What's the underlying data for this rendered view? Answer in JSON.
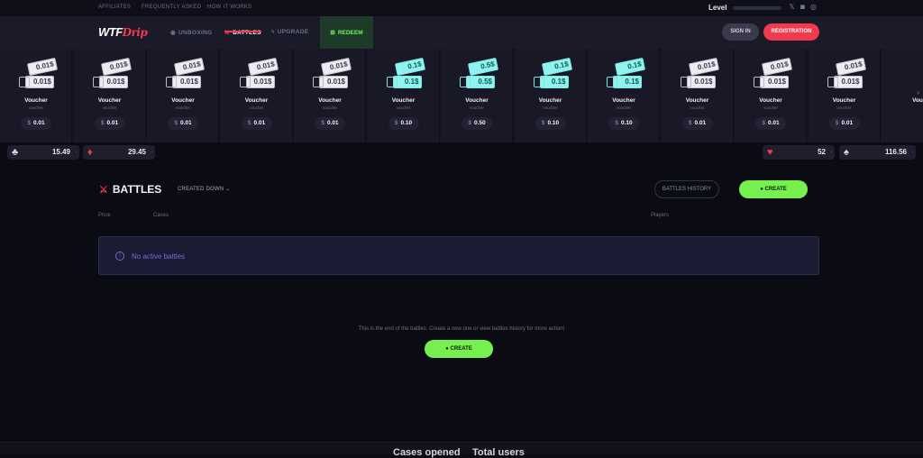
{
  "topbar": {
    "links": [
      "AFFILIATES",
      "FREQUENTLY ASKED",
      "HOW IT WORKS"
    ],
    "level_label": "Level",
    "social_icons": [
      "x-icon",
      "discord-icon",
      "instagram-icon"
    ]
  },
  "navbar": {
    "logo_main": "WTF",
    "logo_accent": "Drip",
    "items": [
      {
        "label": "UNBOXING",
        "icon": "cube-icon",
        "active": false
      },
      {
        "label": "BATTLES",
        "icon": "sword-icon",
        "active": true
      },
      {
        "label": "UPGRADE",
        "icon": "bolt-icon",
        "active": false
      }
    ],
    "redeem_label": "REDEEM",
    "signin_label": "SIGN IN",
    "register_label": "REGISTRATION"
  },
  "vouchers": [
    {
      "ticket": "0.01$",
      "name": "Voucher",
      "sub": "voucher",
      "price": "0.01",
      "tier": "grey"
    },
    {
      "ticket": "0.01$",
      "name": "Voucher",
      "sub": "voucher",
      "price": "0.01",
      "tier": "grey"
    },
    {
      "ticket": "0.01$",
      "name": "Voucher",
      "sub": "voucher",
      "price": "0.01",
      "tier": "grey"
    },
    {
      "ticket": "0.01$",
      "name": "Voucher",
      "sub": "voucher",
      "price": "0.01",
      "tier": "grey"
    },
    {
      "ticket": "0.01$",
      "name": "Voucher",
      "sub": "voucher",
      "price": "0.01",
      "tier": "grey"
    },
    {
      "ticket": "0.1$",
      "name": "Voucher",
      "sub": "voucher",
      "price": "0.10",
      "tier": "cyan"
    },
    {
      "ticket": "0.5$",
      "name": "Voucher",
      "sub": "voucher",
      "price": "0.50",
      "tier": "cyan"
    },
    {
      "ticket": "0.1$",
      "name": "Voucher",
      "sub": "voucher",
      "price": "0.10",
      "tier": "cyan"
    },
    {
      "ticket": "0.1$",
      "name": "Voucher",
      "sub": "voucher",
      "price": "0.10",
      "tier": "cyan"
    },
    {
      "ticket": "0.01$",
      "name": "Voucher",
      "sub": "voucher",
      "price": "0.01",
      "tier": "grey"
    },
    {
      "ticket": "0.01$",
      "name": "Voucher",
      "sub": "voucher",
      "price": "0.01",
      "tier": "grey"
    },
    {
      "ticket": "0.01$",
      "name": "Voucher",
      "sub": "voucher",
      "price": "0.01",
      "tier": "grey"
    },
    {
      "ticket": "",
      "name": "Vou",
      "sub": "",
      "price": "",
      "tier": "grey"
    }
  ],
  "stats": [
    {
      "suit": "♣",
      "value": "15.49",
      "color": "#d8d8e4"
    },
    {
      "suit": "♦",
      "value": "29.45",
      "color": "#ef3b4d"
    },
    {
      "suit": "♥",
      "value": "52",
      "color": "#ef3b4d"
    },
    {
      "suit": "♠",
      "value": "116.56",
      "color": "#d8d8e4"
    }
  ],
  "battles": {
    "title": "BATTLES",
    "sort_label": "CREATED DOWN",
    "history_label": "BATTLES HISTORY",
    "create_label": "CREATE",
    "columns": {
      "price": "Price",
      "cases": "Cases",
      "players": "Players"
    },
    "empty_message": "No active battles",
    "end_message": "This is the end of the battles. Create a new one or view battles history for more action!"
  },
  "footer": {
    "cases_opened": "Cases opened",
    "total_users": "Total users"
  },
  "colors": {
    "accent_red": "#ef3b4d",
    "accent_green": "#76f04e",
    "info_blue": "#6b70d4"
  }
}
